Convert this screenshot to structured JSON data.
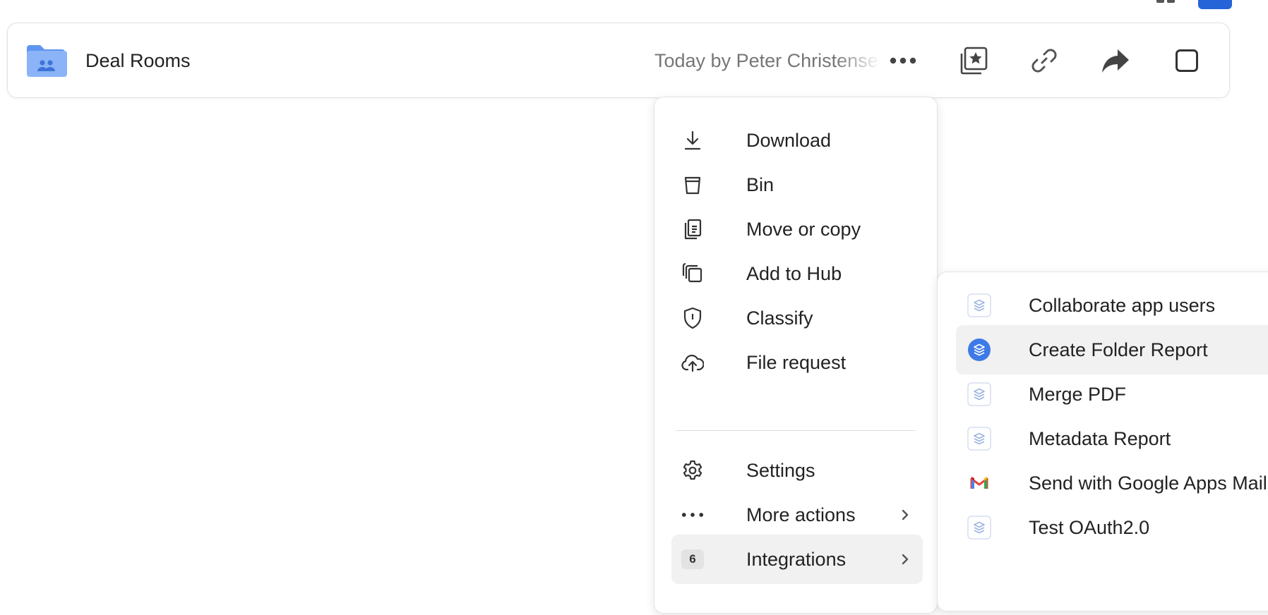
{
  "row": {
    "name": "Deal Rooms",
    "modified": "Today by Peter Christensen",
    "more_label": "More options",
    "favorite_label": "Add to collection",
    "link_label": "Copy shared link",
    "share_label": "Share",
    "select_label": "Select item"
  },
  "menu": {
    "items": [
      {
        "label": "Download",
        "icon": "download-icon"
      },
      {
        "label": "Bin",
        "icon": "bin-icon"
      },
      {
        "label": "Move or copy",
        "icon": "move-copy-icon"
      },
      {
        "label": "Add to Hub",
        "icon": "hub-icon"
      },
      {
        "label": "Classify",
        "icon": "shield-icon"
      },
      {
        "label": "File request",
        "icon": "cloud-upload-icon"
      },
      {
        "label": "Settings",
        "icon": "gear-icon"
      },
      {
        "label": "More actions",
        "icon": "ellipsis-icon"
      },
      {
        "label": "Integrations",
        "icon": "count-badge",
        "badge": "6"
      }
    ]
  },
  "submenu": {
    "items": [
      {
        "label": "Collaborate app users",
        "icon": "app-layers-icon"
      },
      {
        "label": "Create Folder Report",
        "icon": "app-layers-icon"
      },
      {
        "label": "Merge PDF",
        "icon": "app-layers-icon"
      },
      {
        "label": "Metadata Report",
        "icon": "app-layers-icon"
      },
      {
        "label": "Send with Google Apps Mail",
        "icon": "gmail-icon"
      },
      {
        "label": "Test OAuth2.0",
        "icon": "app-layers-icon"
      }
    ]
  },
  "colors": {
    "accent": "#2563d9",
    "folder": "#8bb4f8",
    "folder_dark": "#5f95f0",
    "hover": "#f1f1f1"
  }
}
